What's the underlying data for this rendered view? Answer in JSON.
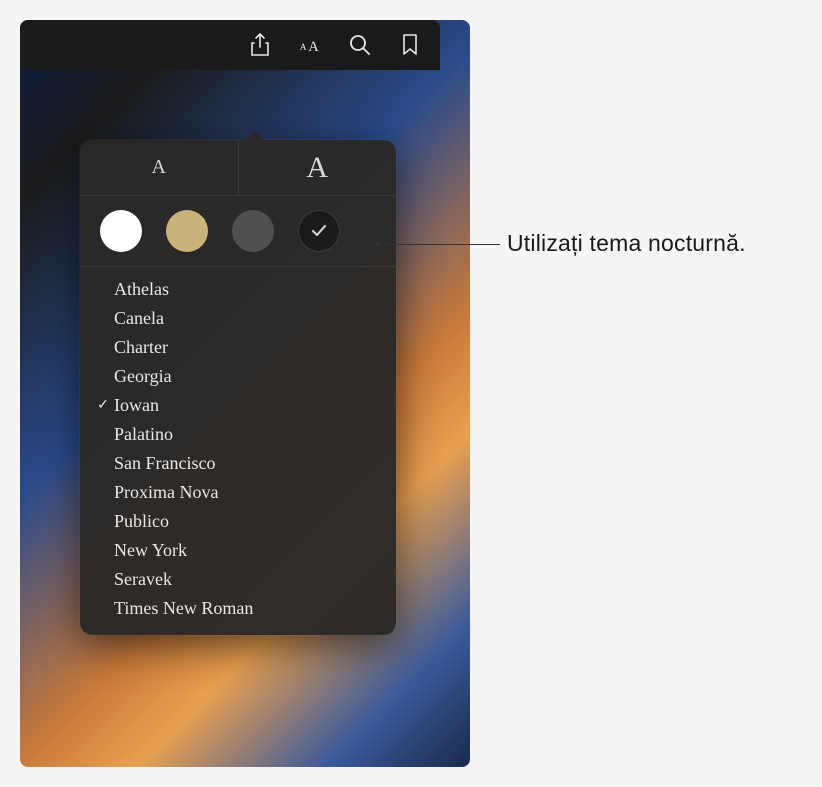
{
  "toolbar": {
    "icons": [
      "share-icon",
      "appearance-icon",
      "search-icon",
      "bookmark-icon"
    ]
  },
  "popover": {
    "fontSize": {
      "smallLabel": "A",
      "largeLabel": "A"
    },
    "themes": [
      {
        "name": "white",
        "selected": false
      },
      {
        "name": "sepia",
        "selected": false
      },
      {
        "name": "gray",
        "selected": false
      },
      {
        "name": "night",
        "selected": true
      }
    ],
    "fonts": [
      {
        "label": "Athelas",
        "selected": false
      },
      {
        "label": "Canela",
        "selected": false
      },
      {
        "label": "Charter",
        "selected": false
      },
      {
        "label": "Georgia",
        "selected": false
      },
      {
        "label": "Iowan",
        "selected": true
      },
      {
        "label": "Palatino",
        "selected": false
      },
      {
        "label": "San Francisco",
        "selected": false
      },
      {
        "label": "Proxima Nova",
        "selected": false
      },
      {
        "label": "Publico",
        "selected": false
      },
      {
        "label": "New York",
        "selected": false
      },
      {
        "label": "Seravek",
        "selected": false
      },
      {
        "label": "Times New Roman",
        "selected": false
      }
    ]
  },
  "callout": {
    "text": "Utilizați tema nocturnă."
  }
}
